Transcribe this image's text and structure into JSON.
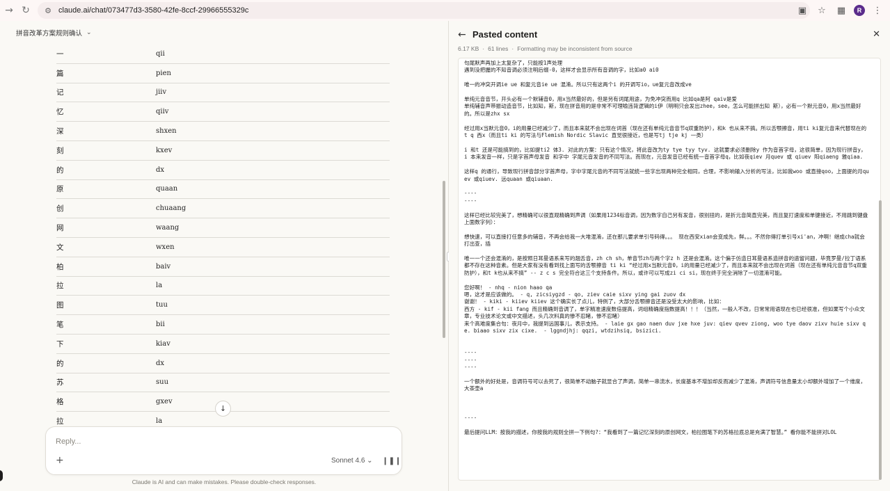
{
  "browser": {
    "url": "claude.ai/chat/073477d3-3580-42fe-8ccf-29966555329c",
    "profile_initial": "R"
  },
  "chat": {
    "title": "拼音改革方案规则确认",
    "rows": [
      [
        "一",
        "qii"
      ],
      [
        "篇",
        "pien"
      ],
      [
        "记",
        "jiiv"
      ],
      [
        "忆",
        "qiiv"
      ],
      [
        "深",
        "shxen"
      ],
      [
        "刻",
        "kxev"
      ],
      [
        "的",
        "dx"
      ],
      [
        "原",
        "quaan"
      ],
      [
        "创",
        "chuaang"
      ],
      [
        "网",
        "waang"
      ],
      [
        "文",
        "wxen"
      ],
      [
        "柏",
        "baiv"
      ],
      [
        "拉",
        "la"
      ],
      [
        "图",
        "tuu"
      ],
      [
        "笔",
        "bii"
      ],
      [
        "下",
        "kiav"
      ],
      [
        "的",
        "dx"
      ],
      [
        "苏",
        "suu"
      ],
      [
        "格",
        "gxev"
      ],
      [
        "拉",
        "la"
      ]
    ],
    "composer_placeholder": "Reply...",
    "model": "Sonnet 4.6",
    "disclaimer": "Claude is AI and can make mistakes. Please double-check responses."
  },
  "panel": {
    "title": "Pasted content",
    "size": "6.17 KB",
    "lines": "61 lines",
    "note": "Formatting may be inconsistent from source",
    "text": "句尾默声再加上太复杂了，只能按1声处理\n遇到没把握的不知音调必须注明后缀-0，这样才会显示所有音调的字，比如a0 ai0\n\n唯一的冲突开调ie ue 和复元音ie ue 混淆。所以只有这两个i 的开调写io，ue复元音改成ve\n\n单纯元音音节，开头必有一个默辅音0，用x当然最好的，但是另有词尾用途，为免冲突而用q 比如qa是阿 qaiv是爱\n单纯辅音声带振动造音节，比如知，斯，现在拼音用的是非常不可理喻违背逻辑的i伊（明明只会发出zhee，see，怎么可能拼出知 斯），必有一个默元音0，用x当然最好的。所以是zhx sx\n\n经过用x当默元音0，i的用量已经减少了，而且本来就不会出现在词首（现在还有单纯元音音节q双重防护），和k 也从来不搞。所以舌颚擦音，用ti ki复元音来代替现在的t q 西x（而且ti ki 的写法与Flemish Nordic Slavic 直觉很接近，也是写tj tje kj 一类）\n\ni 和t 还是可能搞到的，比如提ti2 体3. 对此的方案：只有这个情况，将此音改为ty tye tyy tyv. 这就要求必须删除y 作为音首字母，这很简单，因为现行拼音y，i 本来发音一样，只是字首声母发音 和字中 字尾元音发音的不同写法。而现在，元音发音已经有统一音首字母q，比如夜qiev 月quev 或 qiuev 阳qiaeng 雅qiaa.\n\n这样q 的通行，导致现行拼音部分字首声母，字中字尾元音的不同写法就统一些字出现两种完全相同，合理，不影响输入分析的写法，比如我woo 或直接qoo，上面提的月quev 或qiuev. 远quaan 或qiuaan.\n\n----\n----\n\n这样已经比较完美了，想精确可以很直观精确到声调（如果用1234标音调，因为数字自己另有发音，很别扭的，是折元音简直完美，而且复打速度和单键接近，不用跳到键盘上面数字列）：\n\n想快速，可以直接打任意多的辅音，不再会给我一大堆混淆，还在那儿要求单引号码得。。。 现在西安xian会变成先，鲜。。。不然你得打单引号xi'an，冲啊！继成cha就会打出查，插\n\n唯一一个还会混淆的，是按照日耳曼语系来写的翘舌音，zh ch sh，单音节zh与两个字z h 还是会混淆。这个偏于仿造日耳曼语系造拼音的遗留问题，毕竟罗曼/拉丁语系都不存在这种音素。但是大家有没有看到找上面写的舌颚擦音 ti ki “经过用x当默元音0，i的用量已经减少了，而且本来就不会出现在词首（现在还有单纯元音音节q双重防护），和t k也从来不搞” -- z c s 完全符合这三个支持条件。所以，或许可以写成zi ci si，现在终于完全消除了一切混淆可能。\n\n您好啊！ - nhq - nion haao qa\n嗯，这才是应该做的。 - q, zicsiygzd - qo, ziev caie sixv ying gai zuov dx\n谢谢！ - kiki - kiiev kiiev 这个确实长了点儿，特例了，大部分舌颚擦音还是没受太大的影响，比如：\n西方 - kif - kii fang 而且精确到音调了，单字精准速度数倍提高，词组精确度指数提高！！！（当然，一般人不改，日常常用语现在也已经很准，但如果写个小众文章，专业技术论文或中文描述，头几次料真的惨不忍睹，惨不忍睹）\n来个高难度集合句：夜月中，我提到远国事儿，表示支持。 - laie gx gao naen duv jxe hxe juv: qiev qvev ziong, woo tye daov zixv huie sixv qe. biaao sixv zix cixe.  - lggndjhj: qqzi, wtdzihsiq, bsizici.\n\n\n----\n----\n----\n\n一个额外的好处是，音调符号可以去死了，很简单不动脑子就显合了声调，简单一串流水，长度基本不增加却反而减少了混淆，声调符号信息量太小却额外增加了一个维度，大茶壶a\n\n\n\n----\n\n最后提问LLM：按我的描述，你按我的规则全拼一下例句?：“我看到了一篇记忆深刻的原创网文，柏拉图笔下的苏格拉底总是充满了智慧。” 看你能不能拼对LOL"
  }
}
